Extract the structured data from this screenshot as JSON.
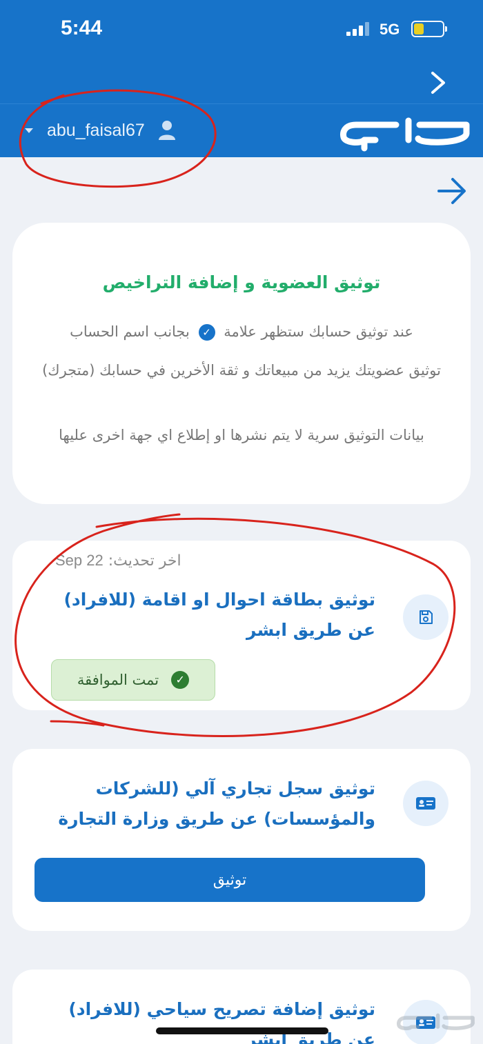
{
  "status_bar": {
    "time": "5:44",
    "network": "5G",
    "battery_level": 0.35,
    "battery_color": "#f5d41b"
  },
  "header": {
    "username": "abu_faisal67",
    "logo_text": "حراج",
    "background_color": "#1773c9"
  },
  "info_card": {
    "title": "توثيق العضوية و إضافة التراخيص",
    "line1_before": "عند توثيق حسابك ستظهر علامة",
    "line1_after": "بجانب اسم الحساب",
    "line2": "توثيق عضويتك يزيد من مبيعاتك و ثقة الأخرين في حسابك (متجرك)",
    "line3": "بيانات التوثيق سرية لا يتم نشرها او إطلاع اي جهة اخرى عليها",
    "title_color": "#22ad6b"
  },
  "id_verification": {
    "last_update_label": "اخر تحديث:",
    "last_update_date": "Sep 22",
    "title": "توثيق بطاقة احوال او اقامة (للافراد) عن طريق ابشر",
    "status": "تمت الموافقة",
    "icon": "save-icon"
  },
  "commercial_registration": {
    "title": "توثيق سجل تجاري آلي (للشركات والمؤسسات) عن طريق وزارة التجارة",
    "button_label": "توثيق",
    "icon": "id-card-icon"
  },
  "tourism_permit": {
    "title": "توثيق إضافة تصريح سياحي (للافراد) عن طريق ابشر",
    "icon": "id-card-icon"
  },
  "watermark_text": "حراج",
  "colors": {
    "primary": "#1773c9",
    "approved_bg": "#dcf0d4",
    "annotation": "#d8231c"
  }
}
